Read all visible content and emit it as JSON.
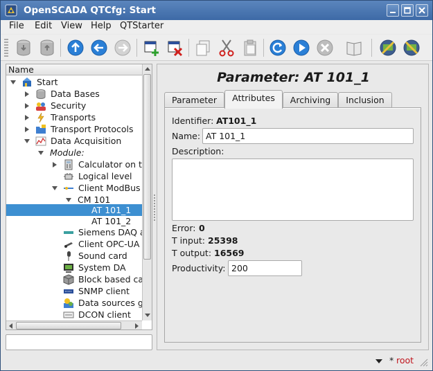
{
  "window": {
    "title": "OpenSCADA QTCfg: Start",
    "controls": [
      "minimize-icon",
      "maximize-icon",
      "close-icon"
    ]
  },
  "menubar": {
    "items": [
      {
        "label": "File"
      },
      {
        "label": "Edit"
      },
      {
        "label": "View"
      },
      {
        "label": "Help"
      },
      {
        "label": "QTStarter"
      }
    ]
  },
  "toolbar": {
    "buttons": [
      "db-load-icon",
      "db-save-icon",
      "up-icon",
      "back-icon",
      "forward-icon",
      "add-item-icon",
      "delete-item-icon",
      "copy-icon",
      "cut-icon",
      "paste-icon",
      "refresh-icon",
      "start-icon",
      "stop-icon",
      "manual-icon",
      "station-icon",
      "station-alt-icon"
    ]
  },
  "tree": {
    "header": "Name",
    "items": [
      {
        "label": "Start",
        "icon": "start-icon"
      },
      {
        "label": "Data Bases",
        "icon": "database-icon"
      },
      {
        "label": "Security",
        "icon": "security-icon"
      },
      {
        "label": "Transports",
        "icon": "transports-icon"
      },
      {
        "label": "Transport Protocols",
        "icon": "protocols-icon"
      },
      {
        "label": "Data Acquisition",
        "icon": "daq-icon"
      },
      {
        "label": "Module:"
      },
      {
        "label": "Calculator on th",
        "icon": "calculator-icon"
      },
      {
        "label": "Logical level",
        "icon": "logical-icon"
      },
      {
        "label": "Client ModBus",
        "icon": "modbus-icon"
      },
      {
        "label": "CM 101"
      },
      {
        "label": "AT 101_1"
      },
      {
        "label": "AT 101_2"
      },
      {
        "label": "Siemens DAQ a",
        "icon": "siemens-icon"
      },
      {
        "label": "Client OPC-UA",
        "icon": "opcua-icon"
      },
      {
        "label": "Sound card",
        "icon": "microphone-icon"
      },
      {
        "label": "System DA",
        "icon": "system-icon"
      },
      {
        "label": "Block based cal",
        "icon": "block-icon"
      },
      {
        "label": "SNMP client",
        "icon": "snmp-icon"
      },
      {
        "label": "Data sources ga",
        "icon": "gate-icon"
      },
      {
        "label": "DCON client",
        "icon": "dcon-icon"
      }
    ]
  },
  "page": {
    "title": "Parameter: AT 101_1",
    "tabs": [
      {
        "label": "Parameter"
      },
      {
        "label": "Attributes"
      },
      {
        "label": "Archiving"
      },
      {
        "label": "Inclusion"
      }
    ],
    "identifier_label": "Identifier:",
    "identifier_value": "AT101_1",
    "name_label": "Name:",
    "name_value": "AT 101_1",
    "description_label": "Description:",
    "description_value": "",
    "error_label": "Error:",
    "error_value": "0",
    "t_input_label": "T input:",
    "t_input_value": "25398",
    "t_output_label": "T output:",
    "t_output_value": "16569",
    "productivity_label": "Productivity:",
    "productivity_value": "200"
  },
  "status": {
    "modified_mark": "*",
    "user": "root"
  },
  "colors": {
    "titlebar": "#4a75ae",
    "selection": "#3d8fd1",
    "user": "#c0141c"
  }
}
